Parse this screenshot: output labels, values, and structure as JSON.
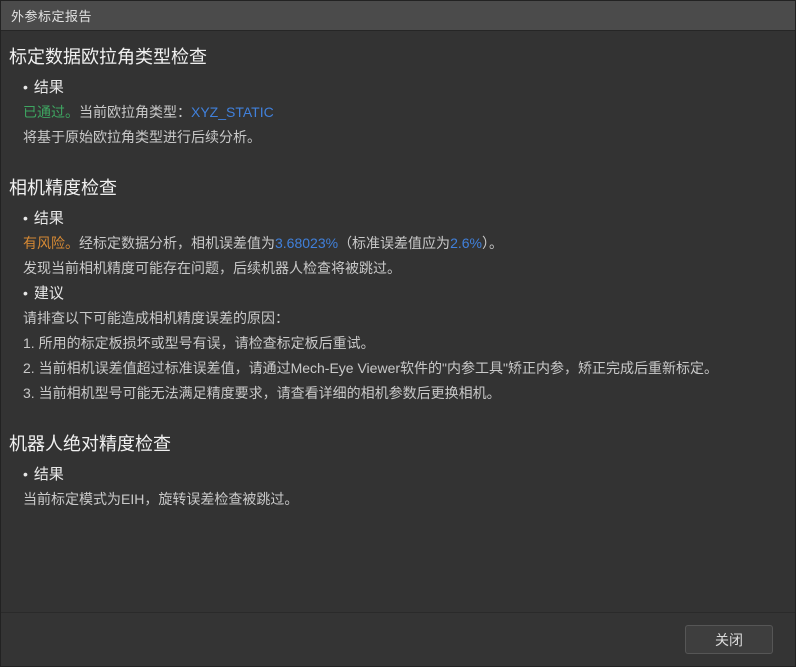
{
  "window": {
    "title": "外参标定报告"
  },
  "colors": {
    "green": "#3ea661",
    "blue": "#4080db",
    "orange": "#d68934"
  },
  "sections": [
    {
      "heading": "标定数据欧拉角类型检查",
      "blocks": [
        {
          "type": "bullet",
          "text": "结果"
        },
        {
          "type": "line",
          "segments": [
            {
              "text": "已通过。",
              "color": "green"
            },
            {
              "text": "当前欧拉角类型："
            },
            {
              "text": "XYZ_STATIC",
              "color": "blue"
            }
          ]
        },
        {
          "type": "line",
          "segments": [
            {
              "text": "将基于原始欧拉角类型进行后续分析。"
            }
          ]
        }
      ]
    },
    {
      "heading": "相机精度检查",
      "blocks": [
        {
          "type": "bullet",
          "text": "结果"
        },
        {
          "type": "line",
          "segments": [
            {
              "text": "有风险。",
              "color": "orange"
            },
            {
              "text": "经标定数据分析，相机误差值为"
            },
            {
              "text": "3.68023%",
              "color": "blue"
            },
            {
              "text": "（标准误差值应为"
            },
            {
              "text": "2.6%",
              "color": "blue"
            },
            {
              "text": "）。"
            }
          ]
        },
        {
          "type": "line",
          "segments": [
            {
              "text": "发现当前相机精度可能存在问题，后续机器人检查将被跳过。"
            }
          ]
        },
        {
          "type": "bullet",
          "text": "建议"
        },
        {
          "type": "line",
          "segments": [
            {
              "text": "请排查以下可能造成相机精度误差的原因："
            }
          ]
        },
        {
          "type": "line",
          "segments": [
            {
              "text": "1. 所用的标定板损坏或型号有误，请检查标定板后重试。"
            }
          ]
        },
        {
          "type": "line",
          "segments": [
            {
              "text": "2. 当前相机误差值超过标准误差值，请通过Mech-Eye Viewer软件的\"内参工具\"矫正内参，矫正完成后重新标定。"
            }
          ]
        },
        {
          "type": "line",
          "segments": [
            {
              "text": "3. 当前相机型号可能无法满足精度要求，请查看详细的相机参数后更换相机。"
            }
          ]
        }
      ]
    },
    {
      "heading": "机器人绝对精度检查",
      "blocks": [
        {
          "type": "bullet",
          "text": "结果"
        },
        {
          "type": "line",
          "segments": [
            {
              "text": "当前标定模式为EIH，旋转误差检查被跳过。"
            }
          ]
        }
      ]
    }
  ],
  "footer": {
    "close_label": "关闭"
  }
}
